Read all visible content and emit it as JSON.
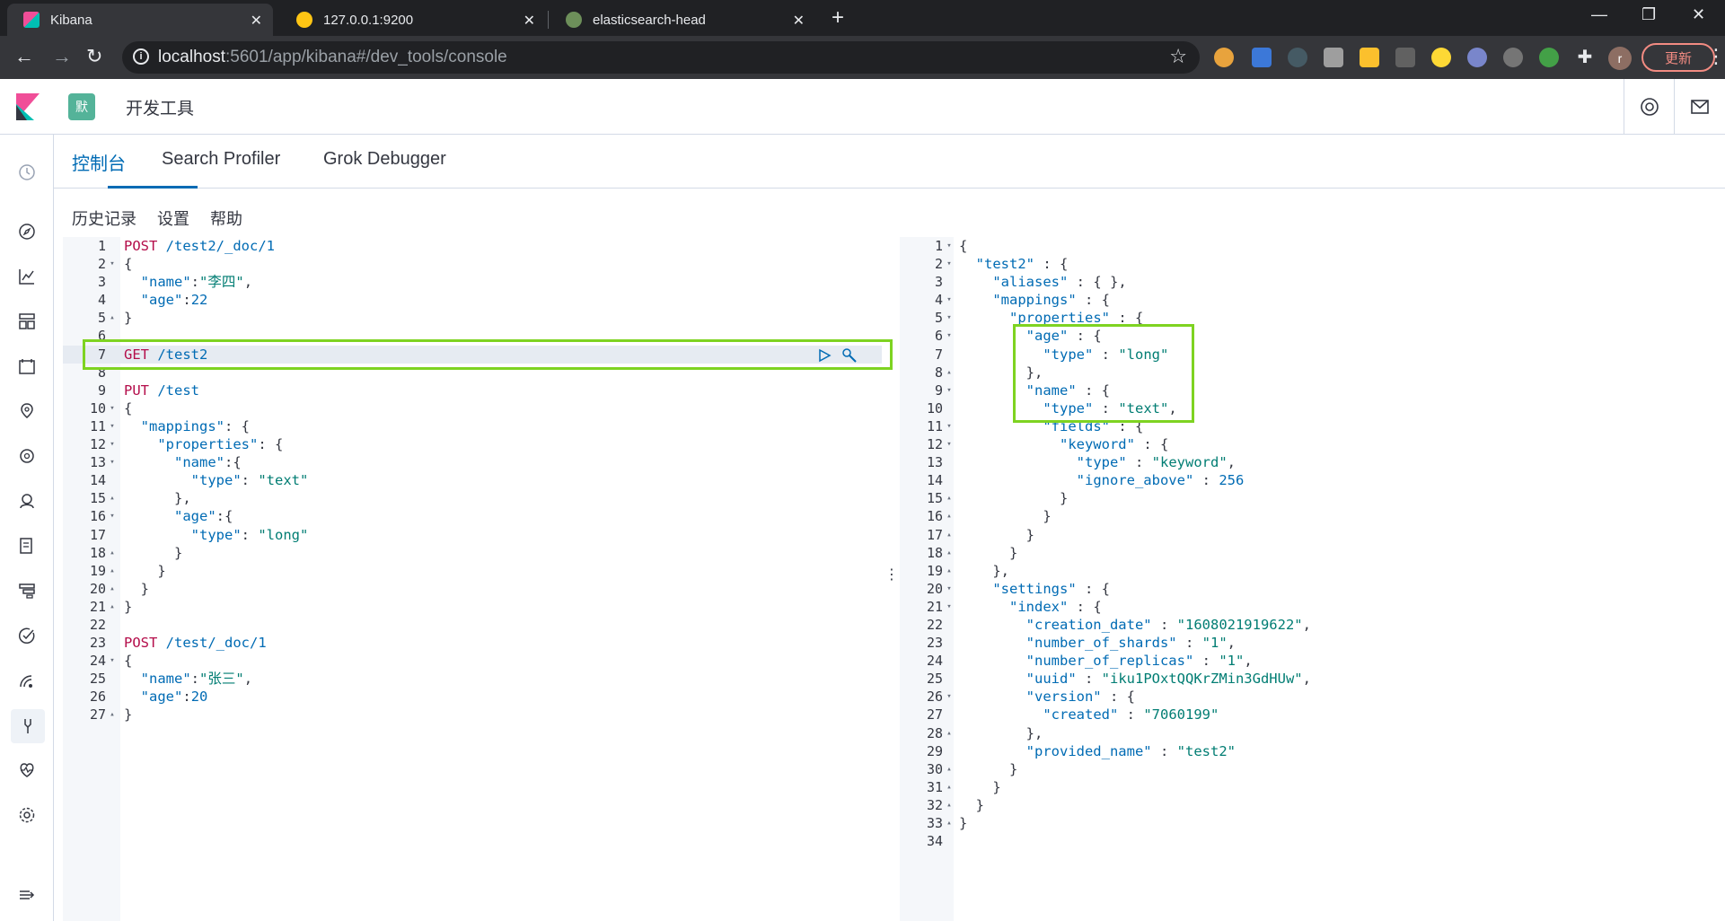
{
  "browser": {
    "tabs": [
      {
        "title": "Kibana",
        "active": true
      },
      {
        "title": "127.0.0.1:9200",
        "active": false
      },
      {
        "title": "elasticsearch-head",
        "active": false
      }
    ],
    "url_host": "localhost",
    "url_rest": ":5601/app/kibana#/dev_tools/console",
    "update_label": "更新",
    "profile_initial": "r"
  },
  "kibana": {
    "space_initial": "默",
    "page_title": "开发工具"
  },
  "devtools": {
    "tabs": [
      "控制台",
      "Search Profiler",
      "Grok Debugger"
    ],
    "active_tab": "控制台",
    "subnav": [
      "历史记录",
      "设置",
      "帮助"
    ]
  },
  "request_editor": {
    "active_line": 7,
    "lines": [
      {
        "n": "1",
        "fold": "",
        "code": "POST /test2/_doc/1"
      },
      {
        "n": "2",
        "fold": "▾",
        "code": "{"
      },
      {
        "n": "3",
        "fold": "",
        "code": "  \"name\":\"李四\","
      },
      {
        "n": "4",
        "fold": "",
        "code": "  \"age\":22"
      },
      {
        "n": "5",
        "fold": "▴",
        "code": "}"
      },
      {
        "n": "6",
        "fold": "",
        "code": ""
      },
      {
        "n": "7",
        "fold": "",
        "code": "GET /test2"
      },
      {
        "n": "8",
        "fold": "",
        "code": ""
      },
      {
        "n": "9",
        "fold": "",
        "code": "PUT /test"
      },
      {
        "n": "10",
        "fold": "▾",
        "code": "{"
      },
      {
        "n": "11",
        "fold": "▾",
        "code": "  \"mappings\": {"
      },
      {
        "n": "12",
        "fold": "▾",
        "code": "    \"properties\": {"
      },
      {
        "n": "13",
        "fold": "▾",
        "code": "      \"name\":{"
      },
      {
        "n": "14",
        "fold": "",
        "code": "        \"type\": \"text\""
      },
      {
        "n": "15",
        "fold": "▴",
        "code": "      },"
      },
      {
        "n": "16",
        "fold": "▾",
        "code": "      \"age\":{"
      },
      {
        "n": "17",
        "fold": "",
        "code": "        \"type\": \"long\""
      },
      {
        "n": "18",
        "fold": "▴",
        "code": "      }"
      },
      {
        "n": "19",
        "fold": "▴",
        "code": "    }"
      },
      {
        "n": "20",
        "fold": "▴",
        "code": "  }"
      },
      {
        "n": "21",
        "fold": "▴",
        "code": "}"
      },
      {
        "n": "22",
        "fold": "",
        "code": ""
      },
      {
        "n": "23",
        "fold": "",
        "code": "POST /test/_doc/1"
      },
      {
        "n": "24",
        "fold": "▾",
        "code": "{"
      },
      {
        "n": "25",
        "fold": "",
        "code": "  \"name\":\"张三\","
      },
      {
        "n": "26",
        "fold": "",
        "code": "  \"age\":20"
      },
      {
        "n": "27",
        "fold": "▴",
        "code": "}"
      }
    ]
  },
  "response_editor": {
    "lines": [
      {
        "n": "1",
        "fold": "▾",
        "code": "{"
      },
      {
        "n": "2",
        "fold": "▾",
        "code": "  \"test2\" : {"
      },
      {
        "n": "3",
        "fold": "",
        "code": "    \"aliases\" : { },"
      },
      {
        "n": "4",
        "fold": "▾",
        "code": "    \"mappings\" : {"
      },
      {
        "n": "5",
        "fold": "▾",
        "code": "      \"properties\" : {"
      },
      {
        "n": "6",
        "fold": "▾",
        "code": "        \"age\" : {"
      },
      {
        "n": "7",
        "fold": "",
        "code": "          \"type\" : \"long\""
      },
      {
        "n": "8",
        "fold": "▴",
        "code": "        },"
      },
      {
        "n": "9",
        "fold": "▾",
        "code": "        \"name\" : {"
      },
      {
        "n": "10",
        "fold": "",
        "code": "          \"type\" : \"text\","
      },
      {
        "n": "11",
        "fold": "▾",
        "code": "          \"fields\" : {"
      },
      {
        "n": "12",
        "fold": "▾",
        "code": "            \"keyword\" : {"
      },
      {
        "n": "13",
        "fold": "",
        "code": "              \"type\" : \"keyword\","
      },
      {
        "n": "14",
        "fold": "",
        "code": "              \"ignore_above\" : 256"
      },
      {
        "n": "15",
        "fold": "▴",
        "code": "            }"
      },
      {
        "n": "16",
        "fold": "▴",
        "code": "          }"
      },
      {
        "n": "17",
        "fold": "▴",
        "code": "        }"
      },
      {
        "n": "18",
        "fold": "▴",
        "code": "      }"
      },
      {
        "n": "19",
        "fold": "▴",
        "code": "    },"
      },
      {
        "n": "20",
        "fold": "▾",
        "code": "    \"settings\" : {"
      },
      {
        "n": "21",
        "fold": "▾",
        "code": "      \"index\" : {"
      },
      {
        "n": "22",
        "fold": "",
        "code": "        \"creation_date\" : \"1608021919622\","
      },
      {
        "n": "23",
        "fold": "",
        "code": "        \"number_of_shards\" : \"1\","
      },
      {
        "n": "24",
        "fold": "",
        "code": "        \"number_of_replicas\" : \"1\","
      },
      {
        "n": "25",
        "fold": "",
        "code": "        \"uuid\" : \"iku1POxtQQKrZMin3GdHUw\","
      },
      {
        "n": "26",
        "fold": "▾",
        "code": "        \"version\" : {"
      },
      {
        "n": "27",
        "fold": "",
        "code": "          \"created\" : \"7060199\""
      },
      {
        "n": "28",
        "fold": "▴",
        "code": "        },"
      },
      {
        "n": "29",
        "fold": "",
        "code": "        \"provided_name\" : \"test2\""
      },
      {
        "n": "30",
        "fold": "▴",
        "code": "      }"
      },
      {
        "n": "31",
        "fold": "▴",
        "code": "    }"
      },
      {
        "n": "32",
        "fold": "▴",
        "code": "  }"
      },
      {
        "n": "33",
        "fold": "▴",
        "code": "}"
      },
      {
        "n": "34",
        "fold": "",
        "code": ""
      }
    ]
  },
  "icons": {
    "sidebar": [
      "clock-icon",
      "compass-icon",
      "visualize-icon",
      "dashboard-icon",
      "canvas-icon",
      "maps-icon",
      "ml-icon",
      "metrics-icon",
      "logs-icon",
      "apm-icon",
      "uptime-icon",
      "siem-icon",
      "dev-tools-icon",
      "monitoring-icon",
      "management-icon",
      "collapse-icon"
    ]
  },
  "colors": {
    "highlight": "#7ed321",
    "accent": "#006bb4",
    "method": "#b40d4a",
    "string": "#017d73"
  }
}
